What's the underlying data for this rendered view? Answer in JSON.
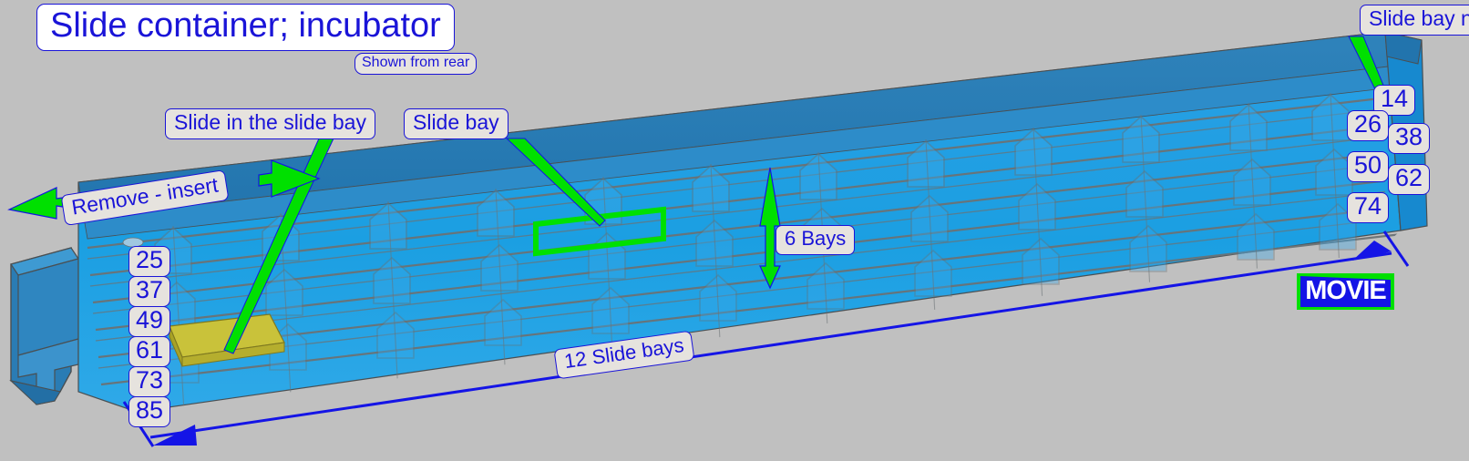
{
  "figure": {
    "title": "Slide container; incubator",
    "subtitle": "Shown from rear",
    "background_color": "#c0c0c0",
    "label_text_color": "#1a14d8",
    "label_fill_color": "#e6e3de",
    "annotation_arrow_color": "#00e000",
    "dimension_line_color": "#1414e6"
  },
  "callouts": {
    "slide_bay_numbering": "Slide bay numbering",
    "slide_in_the_slide_bay": "Slide in the slide bay",
    "slide_bay": "Slide bay",
    "remove_insert": "Remove - insert"
  },
  "dimensions": {
    "bays_vertical": "6 Bays",
    "bays_horizontal": "12 Slide bays"
  },
  "bay_numbering": {
    "left_column": [
      "25",
      "37",
      "49",
      "61",
      "73",
      "85"
    ],
    "right_column_inner": [
      "26",
      "50",
      "74"
    ],
    "right_column_outer": [
      "14",
      "38",
      "62"
    ]
  },
  "badge": {
    "label": "MOVIE",
    "background_color": "#00e000",
    "block_color": "#1414e6",
    "text_color": "#ffffff"
  },
  "geometry": {
    "container_top_color": "#2a7fb8",
    "container_body_color": "#1b9fe2",
    "container_rib_color": "#6b7275",
    "slide_color": "#b8b02c",
    "highlight_outline_color": "#00e000"
  }
}
